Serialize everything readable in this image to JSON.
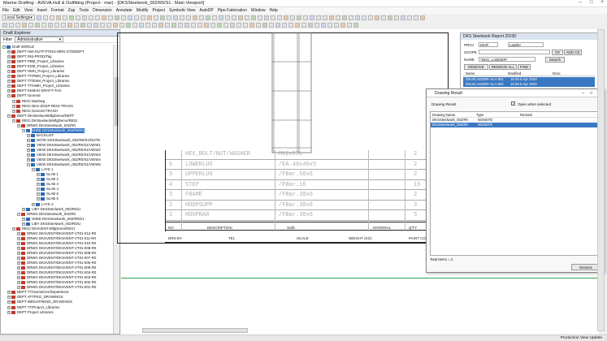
{
  "window": {
    "title": "Marine Drafting - AVEVA Hull & Outfitting (Project : mar) - [DKSSteelwork_002/R0/S1 : Main Viewport]"
  },
  "menu": [
    "File",
    "Edit",
    "View",
    "Insert",
    "Format",
    "Zap",
    "Tools",
    "Dimension",
    "Annotate",
    "Modify",
    "Project",
    "Symbolic View",
    "AutoDP",
    "Pipe Fabrication",
    "Window",
    "Help"
  ],
  "toolbar": {
    "settings_value": "Local Settings"
  },
  "draft_explorer": {
    "title": "Draft Explorer",
    "filter_label": "Filter",
    "filter_value": "Administrative",
    "tree": [
      {
        "indent": 0,
        "label": "Draft WORLD",
        "icon": "b",
        "expand": "−"
      },
      {
        "indent": 1,
        "label": "DEPT HW-OUTFITTING-MRG-STD/DEPT",
        "icon": "r",
        "expand": "+"
      },
      {
        "indent": 1,
        "label": "DEPT INS-PROD/Tag",
        "icon": "r",
        "expand": "+"
      },
      {
        "indent": 1,
        "label": "DEPT PBM_Project_Libraries",
        "icon": "r",
        "expand": "+"
      },
      {
        "indent": 1,
        "label": "DEPT ESM_Project_Libraries",
        "icon": "r",
        "expand": "+"
      },
      {
        "indent": 1,
        "label": "DEPT HMH_Project_Libraries",
        "icon": "r",
        "expand": "+"
      },
      {
        "indent": 1,
        "label": "DEPT TT/PBM_Project_Libraries",
        "icon": "r",
        "expand": "+"
      },
      {
        "indent": 1,
        "label": "DEPT TT/ESM_Project_Libraries",
        "icon": "r",
        "expand": "+"
      },
      {
        "indent": 1,
        "label": "DEPT TT/HMH_Project_Libraries",
        "icon": "r",
        "expand": "+"
      },
      {
        "indent": 1,
        "label": "DEPT KEMAH-DRAFT-TAG",
        "icon": "r",
        "expand": "+"
      },
      {
        "indent": 1,
        "label": "DEPT General",
        "icon": "r",
        "expand": "−"
      },
      {
        "indent": 2,
        "label": "REGI MarDwg",
        "icon": "r",
        "expand": "+"
      },
      {
        "indent": 2,
        "label": "REGI DKS-ZOSP-REGI-TRASH",
        "icon": "r",
        "expand": "+"
      },
      {
        "indent": 2,
        "label": "REGI General-TRASH",
        "icon": "r",
        "expand": "+"
      },
      {
        "indent": 1,
        "label": "DEPT DKSteelworkMfgDemo/DEPT",
        "icon": "r",
        "expand": "−"
      },
      {
        "indent": 2,
        "label": "REGI DKSteelworkMfgDemo/REGI",
        "icon": "r",
        "expand": "−"
      },
      {
        "indent": 3,
        "label": "DRWG DKSSteelwork_002/R0",
        "icon": "r",
        "expand": "−"
      },
      {
        "indent": 4,
        "label": "SHEE DKSSteelwork_002/R0/S1",
        "icon": "b",
        "expand": "−",
        "selected": true
      },
      {
        "indent": 5,
        "label": "BACKLIST",
        "icon": "b",
        "expand": "+"
      },
      {
        "indent": 5,
        "label": "NOTE DKSSteelwork_002/R0/S1/NOTE",
        "icon": "b",
        "expand": "+"
      },
      {
        "indent": 5,
        "label": "VIEW DKSSteelwork_002/R0/S1/VIEW1",
        "icon": "b",
        "expand": "+"
      },
      {
        "indent": 5,
        "label": "VIEW DKSSteelwork_002/R0/S1/VIEW2",
        "icon": "b",
        "expand": "+"
      },
      {
        "indent": 5,
        "label": "VIEW DKSSteelwork_002/R0/S1/VIEW3",
        "icon": "b",
        "expand": "+"
      },
      {
        "indent": 5,
        "label": "VIEW DKSSteelwork_002/R0/S1/VIEW4",
        "icon": "b",
        "expand": "+"
      },
      {
        "indent": 5,
        "label": "VIEW DKSSteelwork_002/R0/S1/VIEW5",
        "icon": "b",
        "expand": "−"
      },
      {
        "indent": 6,
        "label": "LAYE 1",
        "icon": "b",
        "expand": "−"
      },
      {
        "indent": 7,
        "label": "SLAB 1",
        "icon": "b",
        "expand": "+"
      },
      {
        "indent": 7,
        "label": "SLAB 2",
        "icon": "b",
        "expand": "+"
      },
      {
        "indent": 7,
        "label": "SLAB 3",
        "icon": "b",
        "expand": "+"
      },
      {
        "indent": 7,
        "label": "SLAB 4",
        "icon": "b",
        "expand": "+"
      },
      {
        "indent": 7,
        "label": "SLAB 5",
        "icon": "b",
        "expand": "+"
      },
      {
        "indent": 7,
        "label": "SLAB 6",
        "icon": "b",
        "expand": "+"
      },
      {
        "indent": 6,
        "label": "LAYE 2",
        "icon": "b",
        "expand": "+"
      },
      {
        "indent": 4,
        "label": "LIBY DKSSteelwork_002/R0/LI",
        "icon": "b",
        "expand": "+"
      },
      {
        "indent": 3,
        "label": "DRWG DKSSteelwork_002/R0",
        "icon": "r",
        "expand": "−"
      },
      {
        "indent": 4,
        "label": "SHEE DKSSteelwork_002/R0/S1",
        "icon": "b",
        "expand": "+"
      },
      {
        "indent": 4,
        "label": "LIBY DKSSteelwork_002/R0/LI",
        "icon": "b",
        "expand": "+"
      },
      {
        "indent": 2,
        "label": "REGI DKSVENT-MfgDemo/REGI",
        "icon": "r",
        "expand": "−"
      },
      {
        "indent": 3,
        "label": "DRWG DKSVENT/DKSVENT-VT01-012-R0",
        "icon": "r",
        "expand": "+"
      },
      {
        "indent": 3,
        "label": "DRWG DKSVENT/DKSVENT-VT01-011-R0",
        "icon": "r",
        "expand": "+"
      },
      {
        "indent": 3,
        "label": "DRWG DKSVENT/DKSVENT-VT01-010-R0",
        "icon": "r",
        "expand": "+"
      },
      {
        "indent": 3,
        "label": "DRWG DKSVENT/DKSVENT-VT01-009-R0",
        "icon": "r",
        "expand": "+"
      },
      {
        "indent": 3,
        "label": "DRWG DKSVENT/DKSVENT-VT01-008-R0",
        "icon": "r",
        "expand": "+"
      },
      {
        "indent": 3,
        "label": "DRWG DKSVENT/DKSVENT-VT01-007-R0",
        "icon": "r",
        "expand": "+"
      },
      {
        "indent": 3,
        "label": "DRWG DKSVENT/DKSVENT-VT01-006-R0",
        "icon": "r",
        "expand": "+"
      },
      {
        "indent": 3,
        "label": "DRWG DKSVENT/DKSVENT-VT01-005-R0",
        "icon": "r",
        "expand": "+"
      },
      {
        "indent": 3,
        "label": "DRWG DKSVENT/DKSVENT-VT01-004-R0",
        "icon": "r",
        "expand": "+"
      },
      {
        "indent": 3,
        "label": "DRWG DKSVENT/DKSVENT-VT01-003-R0",
        "icon": "r",
        "expand": "+"
      },
      {
        "indent": 3,
        "label": "DRWG DKSVENT/DKSVENT-VT01-002-R0",
        "icon": "r",
        "expand": "+"
      },
      {
        "indent": 3,
        "label": "DRWG DKSVENT/DKSVENT-VT01-001-R0",
        "icon": "r",
        "expand": "+"
      },
      {
        "indent": 1,
        "label": "DEPT TT/Isometrics/Department",
        "icon": "r",
        "expand": "+"
      },
      {
        "indent": 1,
        "label": "DEPT AFTPKG_DRAWINGS",
        "icon": "r",
        "expand": "+"
      },
      {
        "indent": 1,
        "label": "DEPT MEDIATREND_DRAWINGS",
        "icon": "r",
        "expand": "+"
      },
      {
        "indent": 1,
        "label": "DEPT TT/Project_Libraries",
        "icon": "r",
        "expand": "+"
      },
      {
        "indent": 1,
        "label": "DEPT Project Libraries",
        "icon": "r",
        "expand": "+"
      }
    ]
  },
  "bom": {
    "header": {
      "no": "NO",
      "desc": "DESCRIPTION",
      "size": "SIZE",
      "material": "MATERIAL",
      "qty": "Q'TY"
    },
    "rows": [
      {
        "no": "",
        "desc": "HEX_BOLT/NUT/WASHER",
        "size": "M12x25L",
        "qty": "2"
      },
      {
        "no": "6",
        "desc": "LOWERLUG",
        "size": "/EA.40x40x5",
        "qty": "2"
      },
      {
        "no": "5",
        "desc": "UPPERLUG",
        "size": "/FBar.50x6",
        "qty": "2"
      },
      {
        "no": "4",
        "desc": "STEP",
        "size": "/FBar.16",
        "qty": "15"
      },
      {
        "no": "3",
        "desc": "FRAME",
        "size": "/FBar.38x6",
        "qty": "2"
      },
      {
        "no": "2",
        "desc": "HOOPSUPP",
        "size": "/FBar.38x6",
        "qty": "3"
      },
      {
        "no": "1",
        "desc": "HOOPBAR",
        "size": "/FBar.38x6",
        "qty": "5"
      }
    ],
    "footer": {
      "drn": "DRN BY",
      "tel": "TEL",
      "scale": "SCALE",
      "weight": "WEIGHT (KG)",
      "paint": "PAINT CO"
    }
  },
  "report_panel": {
    "title": "DKS Steelwork Report 2D/3D",
    "proj_label": "PROJ",
    "proj_value": "MAR",
    "proj_type": "Ladder",
    "scope_label": "SCOPE",
    "ce_label": "CE",
    "add_ce_label": "ADD CE",
    "name_label": "NAME",
    "name_value": "*DKS_LADDER*",
    "search_label": "Search",
    "remove_label": "REMOVE",
    "remove_all_label": "REMOVE ALL",
    "find_label": "FIND",
    "columns": [
      "Name",
      "Modified",
      "Desc"
    ],
    "rows": [
      {
        "name": "/DKS/LADDER-VLA-001",
        "modified": "15:48  5 Apr 2020",
        "desc": ""
      },
      {
        "name": "/DKS/LADDER-VLA-002",
        "modified": "15:48  5 Apr 2020",
        "desc": ""
      }
    ]
  },
  "drawing_dialog": {
    "title": "Drawing Result",
    "label": "Drawing Result",
    "checkbox_label": "Open when selected",
    "checkbox_checked": true,
    "columns": [
      "Drawing Name",
      "Type",
      "Remark"
    ],
    "rows": [
      {
        "name": "DKSSteelwork_002/R0",
        "type": "NONSTD",
        "remark": "",
        "selected": false
      },
      {
        "name": "DKSSteelwork_002/R0",
        "type": "NONSTD",
        "remark": "",
        "selected": true
      }
    ],
    "total": "Total Items = 2",
    "dismiss_label": "Dismiss"
  },
  "status": {
    "text": "Production View  Update"
  }
}
